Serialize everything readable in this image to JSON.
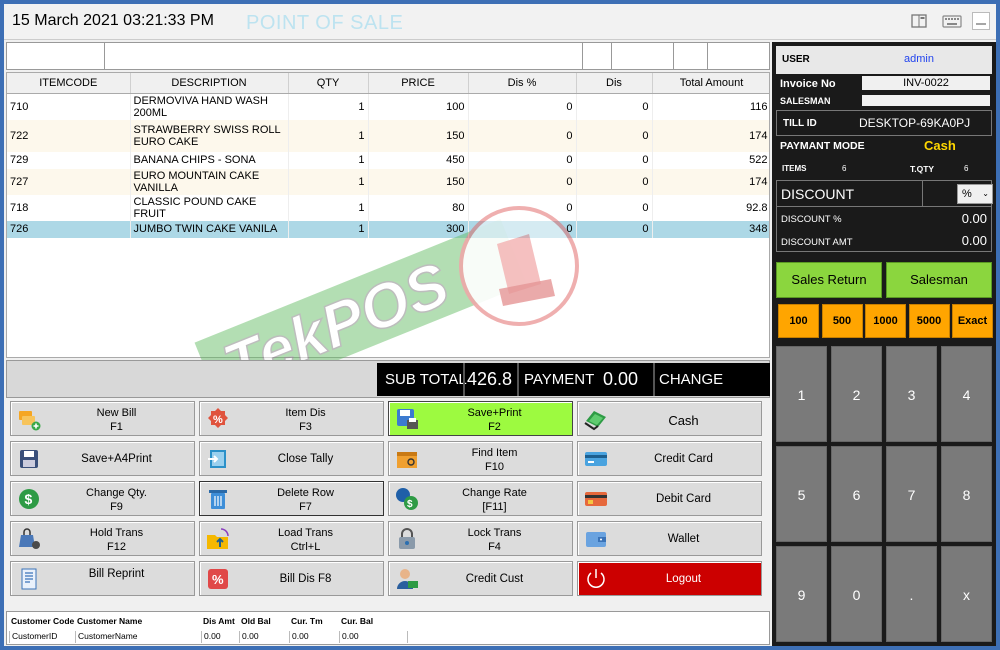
{
  "header": {
    "datetime": "15 March 2021 03:21:33 PM",
    "app_title": "POINT OF SALE"
  },
  "grid": {
    "columns": [
      "ITEMCODE",
      "DESCRIPTION",
      "QTY",
      "PRICE",
      "Dis %",
      "Dis",
      "Total Amount"
    ],
    "rows": [
      [
        "710",
        "DERMOVIVA HAND WASH 200ML",
        "1",
        "100",
        "0",
        "0",
        "116"
      ],
      [
        "722",
        "STRAWBERRY SWISS ROLL EURO CAKE",
        "1",
        "150",
        "0",
        "0",
        "174"
      ],
      [
        "729",
        "BANANA CHIPS -  SONA",
        "1",
        "450",
        "0",
        "0",
        "522"
      ],
      [
        "727",
        "EURO MOUNTAIN CAKE VANILLA",
        "1",
        "150",
        "0",
        "0",
        "174"
      ],
      [
        "718",
        "CLASSIC POUND CAKE FRUIT",
        "1",
        "80",
        "0",
        "0",
        "92.8"
      ],
      [
        "726",
        "JUMBO TWIN CAKE VANILA",
        "1",
        "300",
        "0",
        "0",
        "348"
      ]
    ],
    "selected_row": 5
  },
  "watermark": {
    "text": "TekPOS"
  },
  "totals": {
    "subtotal_label": "SUB TOTAL",
    "subtotal_value": "426.8",
    "payment_label": "PAYMENT",
    "payment_value": "0.00",
    "change_label": "CHANGE"
  },
  "buttons": [
    {
      "id": "new-bill",
      "l1": "New Bill",
      "l2": "F1"
    },
    {
      "id": "item-dis",
      "l1": "Item Dis",
      "l2": "F3"
    },
    {
      "id": "save-print",
      "l1": "Save+Print",
      "l2": "F2"
    },
    {
      "id": "cash",
      "l1": "Cash",
      "l2": ""
    },
    {
      "id": "save-a4print",
      "l1": "Save+A4Print",
      "l2": ""
    },
    {
      "id": "close-tally",
      "l1": "Close Tally",
      "l2": ""
    },
    {
      "id": "find-item",
      "l1": "Find Item",
      "l2": "F10"
    },
    {
      "id": "credit-card",
      "l1": "Credit Card",
      "l2": ""
    },
    {
      "id": "change-qty",
      "l1": "Change Qty.",
      "l2": "F9"
    },
    {
      "id": "delete-row",
      "l1": "Delete Row",
      "l2": "F7"
    },
    {
      "id": "change-rate",
      "l1": "Change Rate",
      "l2": "[F11]"
    },
    {
      "id": "debit-card",
      "l1": "Debit Card",
      "l2": ""
    },
    {
      "id": "hold-trans",
      "l1": "Hold Trans",
      "l2": "F12"
    },
    {
      "id": "load-trans",
      "l1": "Load Trans",
      "l2": "Ctrl+L"
    },
    {
      "id": "lock-trans",
      "l1": "Lock Trans",
      "l2": "F4"
    },
    {
      "id": "wallet",
      "l1": "Wallet",
      "l2": ""
    },
    {
      "id": "bill-reprint",
      "l1": "Bill Reprint",
      "l2": ""
    },
    {
      "id": "bill-dis",
      "l1": "Bill Dis  F8",
      "l2": ""
    },
    {
      "id": "credit-cust",
      "l1": "Credit Cust",
      "l2": ""
    },
    {
      "id": "logout",
      "l1": "Logout",
      "l2": ""
    }
  ],
  "customer": {
    "h_code": "Customer Code",
    "h_name": "Customer Name",
    "h_disamt": "Dis Amt",
    "h_oldbal": "Old Bal",
    "h_curtm": "Cur. Tm",
    "h_curbal": "Cur. Bal",
    "v_code": "CustomerID",
    "v_name": "CustomerName",
    "v_disamt": "0.00",
    "v_oldbal": "0.00",
    "v_curtm": "0.00",
    "v_curbal": "0.00"
  },
  "panel": {
    "user_label": "USER",
    "user_value": "admin",
    "invoice_label": "Invoice No",
    "invoice_value": "INV-0022",
    "salesman_label": "SALESMAN",
    "salesman_value": "",
    "till_label": "TILL ID",
    "till_value": "DESKTOP-69KA0PJ",
    "payment_mode_label": "PAYMANT MODE",
    "payment_mode_value": "Cash",
    "items_label": "ITEMS",
    "items_value": "6",
    "tqty_label": "T.QTY",
    "tqty_value": "6",
    "discount_label": "DISCOUNT",
    "discount_type": "%",
    "discount_pct_label": "DISCOUNT %",
    "discount_pct_value": "0.00",
    "discount_amt_label": "DISCOUNT AMT",
    "discount_amt_value": "0.00",
    "sales_return": "Sales Return",
    "salesman_btn": "Salesman",
    "quick": [
      "100",
      "500",
      "1000",
      "5000",
      "Exact"
    ],
    "keypad": [
      "1",
      "2",
      "3",
      "4",
      "5",
      "6",
      "7",
      "8",
      "9",
      "0",
      ".",
      "x"
    ]
  },
  "colors": {
    "accent_green": "#9dfa40",
    "logout_red": "#cc0000",
    "quick_orange": "#ffa500",
    "cash_yellow": "#ffd700",
    "selected_row": "#add8e6"
  }
}
